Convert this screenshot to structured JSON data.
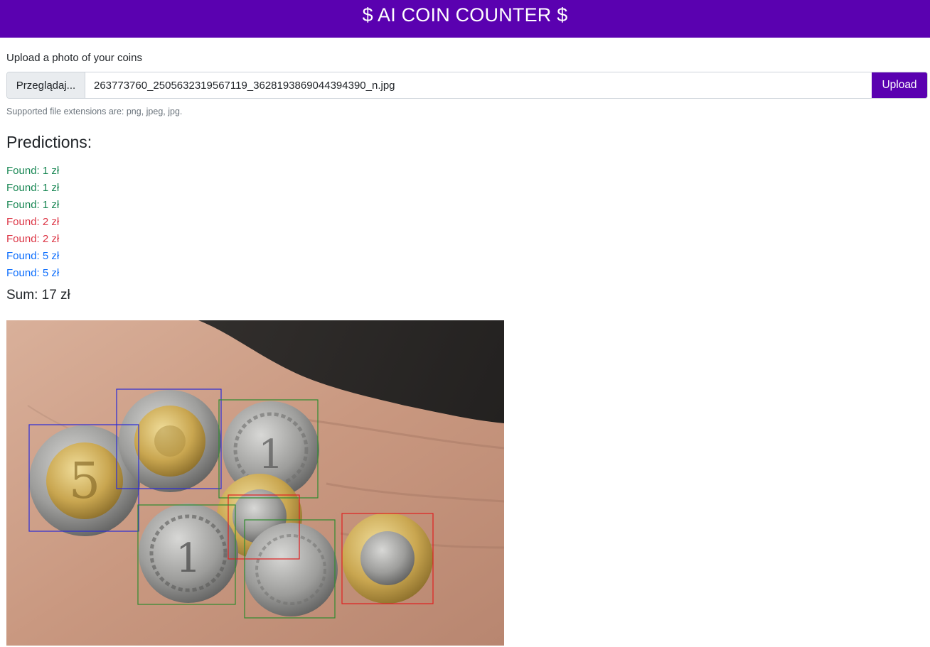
{
  "header": {
    "title": "$ AI COIN COUNTER $"
  },
  "form": {
    "label": "Upload a photo of your coins",
    "browse_label": "Przeglądaj...",
    "file_name": "263773760_2505632319567119_3628193869044394390_n.jpg",
    "upload_label": "Upload",
    "help_text": "Supported file extensions are: png, jpeg, jpg."
  },
  "predictions": {
    "title": "Predictions:",
    "items": [
      {
        "text": "Found: 1 zł",
        "color": "#198754"
      },
      {
        "text": "Found: 1 zł",
        "color": "#198754"
      },
      {
        "text": "Found: 1 zł",
        "color": "#198754"
      },
      {
        "text": "Found: 2 zł",
        "color": "#dc3545"
      },
      {
        "text": "Found: 2 zł",
        "color": "#dc3545"
      },
      {
        "text": "Found: 5 zł",
        "color": "#0d6efd"
      },
      {
        "text": "Found: 5 zł",
        "color": "#0d6efd"
      }
    ],
    "sum": "Sum: 17 zł"
  },
  "colors": {
    "brand": "#5a01b0",
    "one_zl": "#198754",
    "two_zl": "#dc3545",
    "five_zl": "#0d6efd"
  }
}
